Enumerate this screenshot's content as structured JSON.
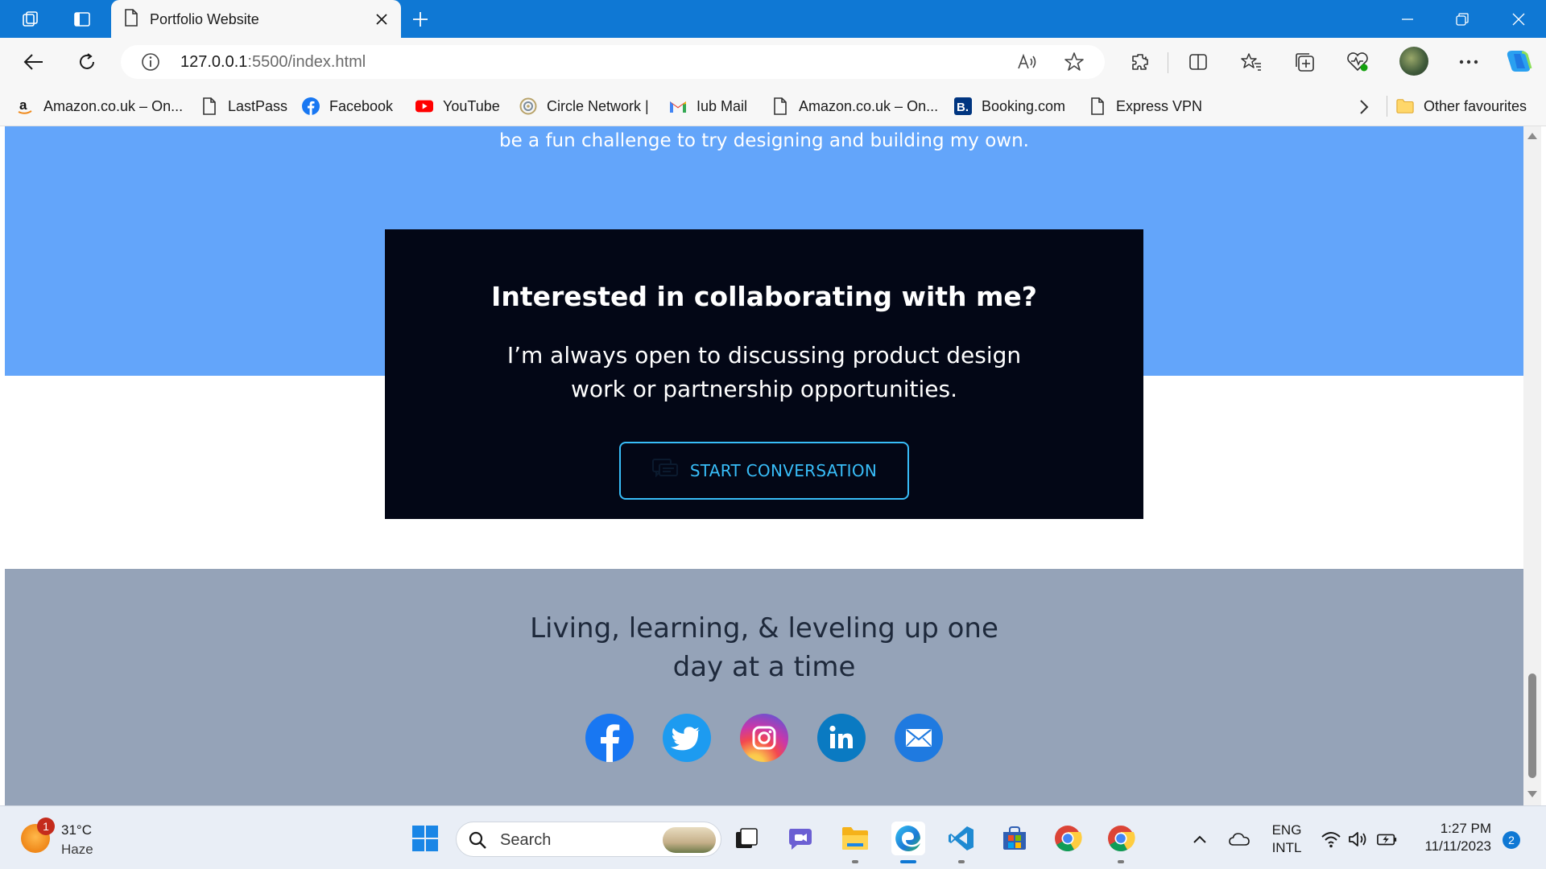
{
  "browser": {
    "tab_title": "Portfolio Website",
    "url_host": "127.0.0.1",
    "url_rest": ":5500/index.html"
  },
  "favourites": [
    {
      "label": "Amazon.co.uk – On...",
      "icon": "amazon-icon"
    },
    {
      "label": "LastPass",
      "icon": "page-icon"
    },
    {
      "label": "Facebook",
      "icon": "facebook-icon"
    },
    {
      "label": "YouTube",
      "icon": "youtube-icon"
    },
    {
      "label": "Circle Network |",
      "icon": "circle-network-icon"
    },
    {
      "label": "Iub Mail",
      "icon": "gmail-icon"
    },
    {
      "label": "Amazon.co.uk – On...",
      "icon": "page-icon"
    },
    {
      "label": "Booking.com",
      "icon": "booking-icon"
    },
    {
      "label": "Express VPN",
      "icon": "page-icon"
    }
  ],
  "other_favourites": "Other favourites",
  "page": {
    "intro_tail": "be a fun challenge to try designing and building my own.",
    "cta": {
      "title": "Interested in collaborating with me?",
      "body_line1": "I’m always open to discussing product design",
      "body_line2": "work or partnership opportunities.",
      "button_label": "START CONVERSATION"
    },
    "footer": {
      "tagline_line1": "Living, learning, & leveling up one",
      "tagline_line2": "day at a time",
      "social_icons": [
        "facebook-icon",
        "twitter-icon",
        "instagram-icon",
        "linkedin-icon",
        "email-icon"
      ]
    }
  },
  "colors": {
    "blue_band": "#63a5fa",
    "cta_bg": "#030716",
    "accent": "#38bdf8",
    "footer_bg": "#95a3b8",
    "titlebar": "#0f78d4"
  },
  "taskbar": {
    "weather_temp": "31°C",
    "weather_cond": "Haze",
    "weather_badge": "1",
    "search_placeholder": "Search",
    "lang_top": "ENG",
    "lang_bottom": "INTL",
    "time": "1:27 PM",
    "date": "11/11/2023",
    "notifications": "2"
  }
}
